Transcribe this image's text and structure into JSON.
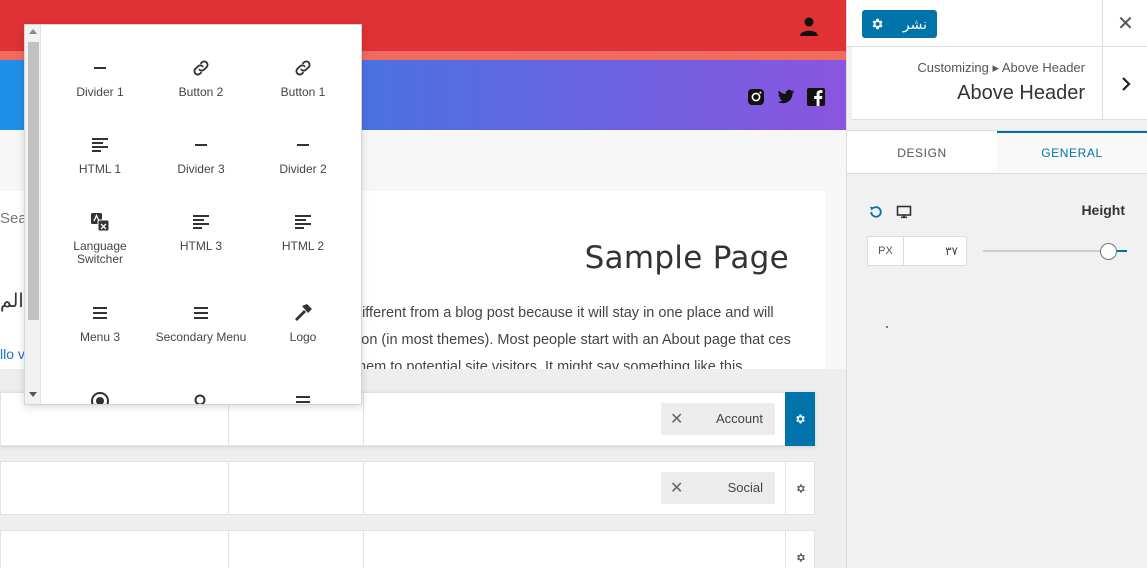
{
  "preview": {
    "page_title": "Sample Page",
    "search_fragment": "Sea",
    "arabic_fragment": "ى الم",
    "link_fragment": "llo v",
    "page_body": "different from a blog post because it will stay in one place and will                     tion (in most themes). Most people start with an About page that                     ces them to potential site visitors. It might say something like this"
  },
  "popup": {
    "items": [
      {
        "label": "Divider 1",
        "icon": "divider-icon"
      },
      {
        "label": "Button 2",
        "icon": "link-icon"
      },
      {
        "label": "Button 1",
        "icon": "link-icon"
      },
      {
        "label": "HTML 1",
        "icon": "text-align-icon"
      },
      {
        "label": "Divider 3",
        "icon": "divider-icon"
      },
      {
        "label": "Divider 2",
        "icon": "divider-icon"
      },
      {
        "label": "Language Switcher",
        "icon": "translate-icon"
      },
      {
        "label": "HTML 3",
        "icon": "text-align-icon"
      },
      {
        "label": "HTML 2",
        "icon": "text-align-icon"
      },
      {
        "label": "Menu 3",
        "icon": "menu-icon"
      },
      {
        "label": "Secondary Menu",
        "icon": "menu-icon"
      },
      {
        "label": "Logo",
        "icon": "hammer-icon"
      }
    ]
  },
  "builder": {
    "row1_chip": "Account",
    "row2_chip": "Social"
  },
  "panel": {
    "publish_label": "نشر",
    "breadcrumb": "Customizing ▸ Above Header",
    "section_title": "Above Header",
    "tab_design": "DESIGN",
    "tab_general": "GENERAL",
    "height_label": "Height",
    "unit": "PX",
    "height_value": "۳۷",
    "slider_fraction": 0.85
  },
  "colors": {
    "topbar": "#e03234",
    "accent": "#0073aa",
    "gradient_start": "#1e90e8",
    "gradient_end": "#8a55df"
  }
}
